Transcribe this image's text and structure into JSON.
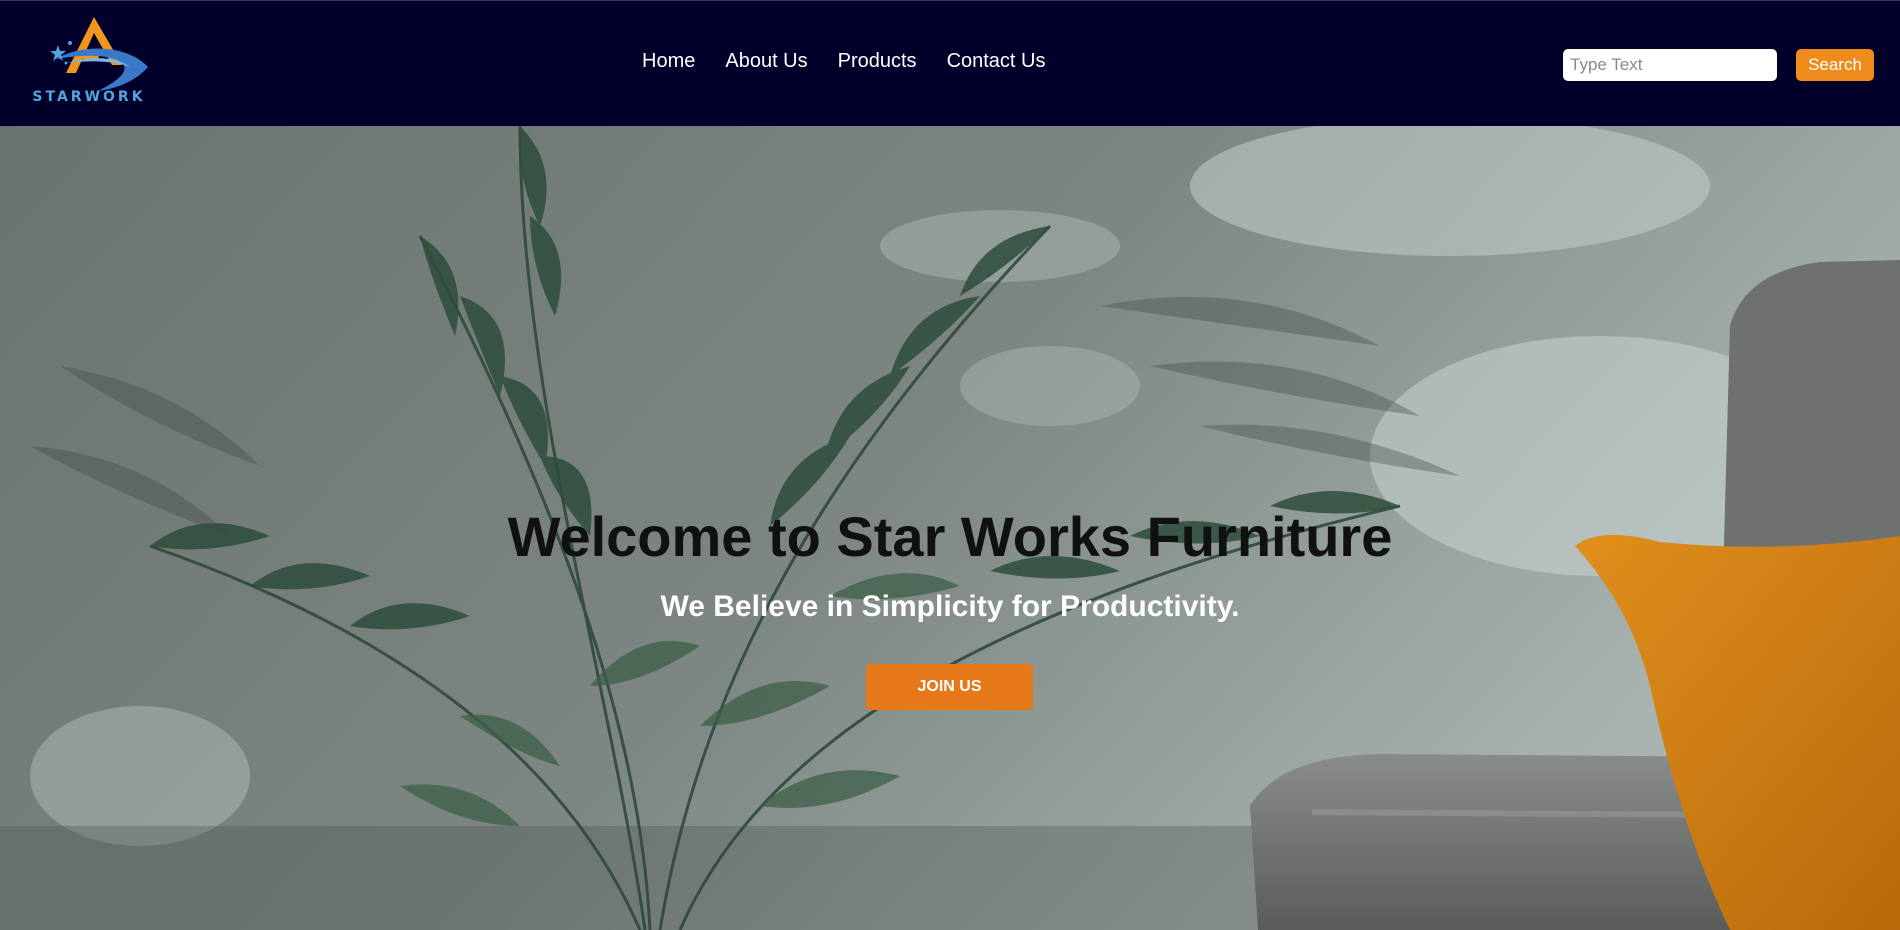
{
  "header": {
    "logo": {
      "icon": "starwork-logo-icon",
      "text": "STARWORK"
    },
    "nav": [
      {
        "label": "Home"
      },
      {
        "label": "About Us"
      },
      {
        "label": "Products"
      },
      {
        "label": "Contact Us"
      }
    ],
    "search": {
      "placeholder": "Type Text",
      "value": "",
      "button_label": "Search"
    }
  },
  "hero": {
    "title": "Welcome to Star Works Furniture",
    "subtitle": "We Believe in Simplicity for Productivity.",
    "cta_label": "JOIN US"
  },
  "colors": {
    "navbar_bg": "#00002a",
    "accent": "#ef8c1c",
    "cta": "#e57919",
    "logo_blue": "#4fa6dc"
  }
}
